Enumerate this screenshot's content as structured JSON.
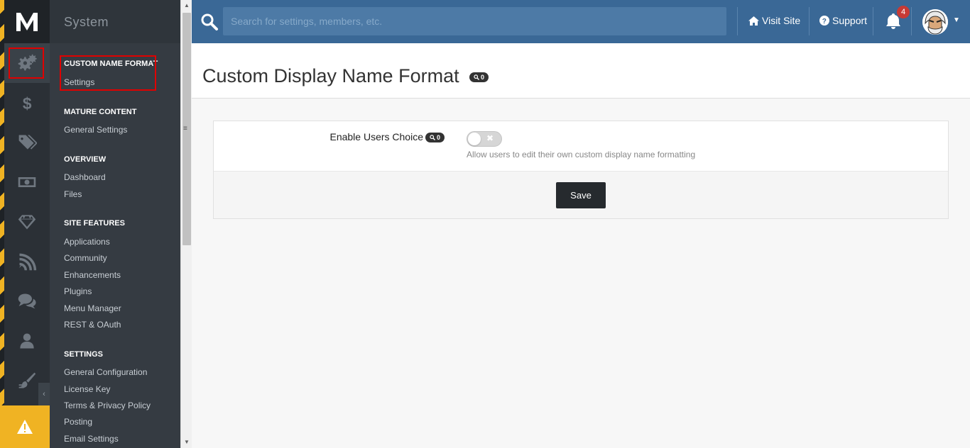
{
  "sidebar": {
    "section_title": "System",
    "groups": [
      {
        "title": "Custom Name Format",
        "links": [
          "Settings"
        ]
      },
      {
        "title": "Mature Content",
        "links": [
          "General Settings"
        ]
      },
      {
        "title": "Overview",
        "links": [
          "Dashboard",
          "Files"
        ]
      },
      {
        "title": "Site Features",
        "links": [
          "Applications",
          "Community",
          "Enhancements",
          "Plugins",
          "Menu Manager",
          "REST & OAuth"
        ]
      },
      {
        "title": "Settings",
        "links": [
          "General Configuration",
          "License Key",
          "Terms & Privacy Policy",
          "Posting",
          "Email Settings"
        ]
      }
    ],
    "rail_icons": [
      "cogs-icon",
      "dollar-icon",
      "tags-icon",
      "money-icon",
      "diamond-icon",
      "rss-icon",
      "comments-icon",
      "user-icon",
      "paintbrush-icon",
      "warning-icon"
    ]
  },
  "topbar": {
    "search_placeholder": "Search for settings, members, etc.",
    "visit_site": "Visit Site",
    "support": "Support",
    "notification_count": "4"
  },
  "page": {
    "title": "Custom Display Name Format",
    "title_search_count": "0"
  },
  "form": {
    "field_label": "Enable Users Choice",
    "field_search_count": "0",
    "toggle_on": false,
    "description": "Allow users to edit their own custom display name formatting",
    "save_label": "Save"
  },
  "colors": {
    "topbar": "#3a6896",
    "accent_yellow": "#f0b323",
    "highlight_red": "#e00000",
    "badge_red": "#c73a35"
  }
}
